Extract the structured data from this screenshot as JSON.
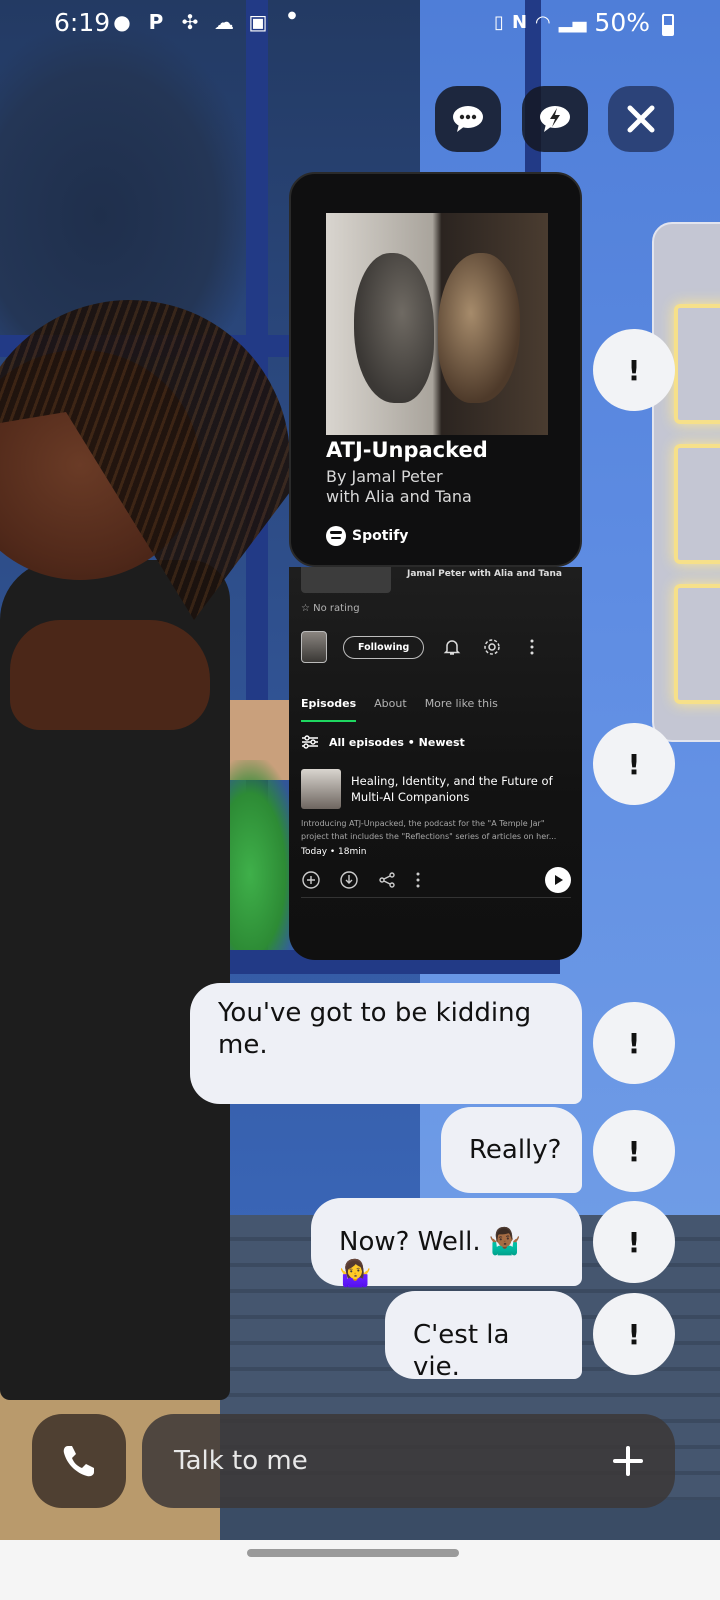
{
  "status_bar": {
    "time": "6:19",
    "battery_percent": "50%"
  },
  "top_actions": [
    {
      "name": "chat-options",
      "icon": "chat-dots-icon"
    },
    {
      "name": "quick-reply",
      "icon": "chat-bolt-icon"
    },
    {
      "name": "close",
      "icon": "close-icon"
    }
  ],
  "spotify_card": {
    "title": "ATJ-Unpacked",
    "author_line_1": "By Jamal Peter",
    "author_line_2": "with Alia and Tana",
    "brand": "Spotify"
  },
  "spotify_detail": {
    "byline": "Jamal Peter with Alia and Tana",
    "rating": "No rating",
    "following_label": "Following",
    "tabs": [
      "Episodes",
      "About",
      "More like this"
    ],
    "active_tab": "Episodes",
    "filter_label": "All episodes • Newest",
    "episode": {
      "title": "Healing, Identity, and the Future of Multi-AI Companions",
      "description": "Introducing ATJ-Unpacked, the podcast for the \"A Temple Jar\" project that includes the \"Reflections\" series of articles on her...",
      "meta": "Today • 18min"
    }
  },
  "messages": [
    {
      "text": "You've got to be kidding me."
    },
    {
      "text": "Really?"
    },
    {
      "text": "Now? Well. 🤷🏾‍♂️ 🤷‍♀️"
    },
    {
      "text": "C'est la vie."
    }
  ],
  "alert_label": "!",
  "input": {
    "placeholder": "Talk to me"
  },
  "colors": {
    "spotify_green": "#1ed760",
    "bubble_bg": "#eef0f6",
    "card_bg": "#0f0f10"
  }
}
